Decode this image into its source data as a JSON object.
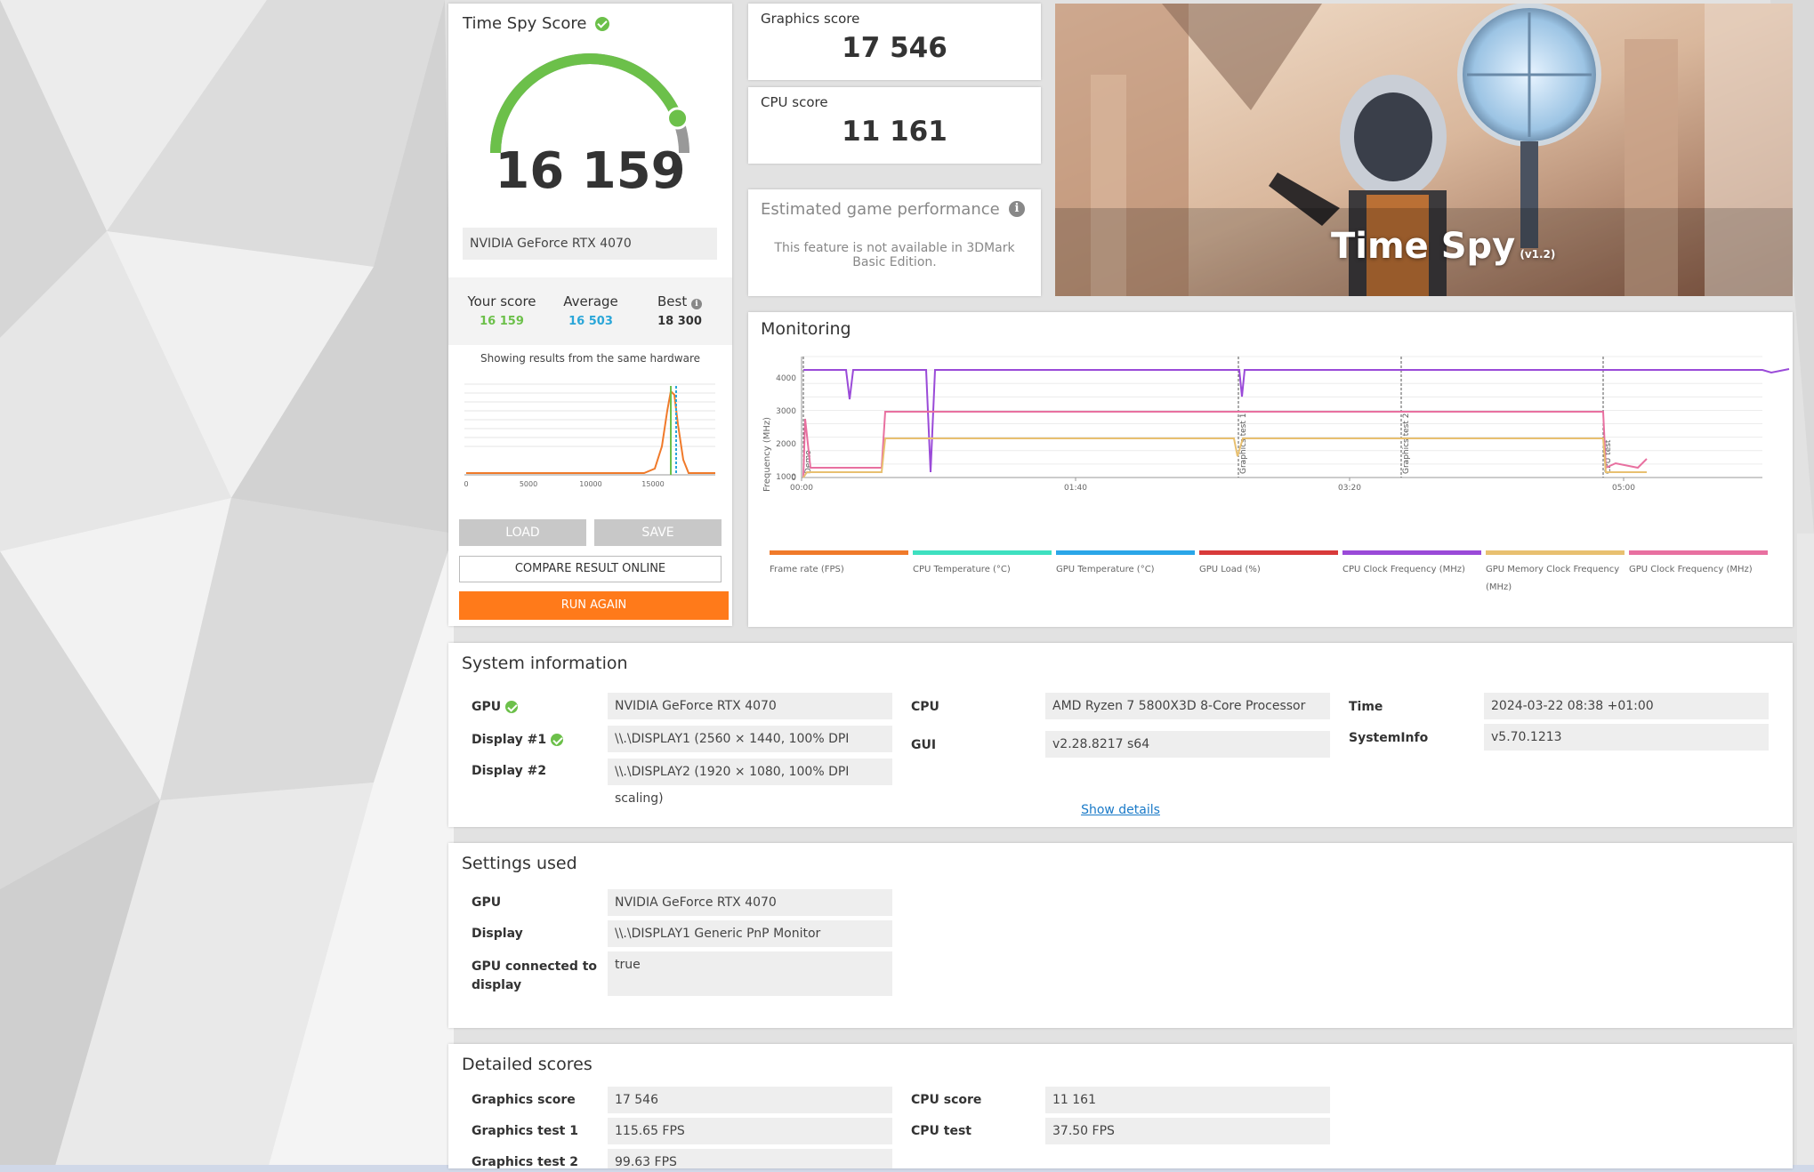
{
  "score_panel": {
    "title": "Time Spy Score",
    "score": "16 159",
    "gpu_name": "NVIDIA GeForce RTX 4070",
    "your_score_label": "Your score",
    "your_score_value": "16 159",
    "average_label": "Average",
    "average_value": "16 503",
    "best_label": "Best",
    "best_value": "18 300",
    "showing_results": "Showing results from the same hardware",
    "histogram_ticks": [
      "0",
      "5000",
      "10000",
      "15000"
    ],
    "load_label": "LOAD",
    "save_label": "SAVE",
    "compare_label": "COMPARE RESULT ONLINE",
    "run_again_label": "RUN AGAIN",
    "gauge_fraction": 0.88,
    "colors": {
      "accent_green": "#6cc04a",
      "average_blue": "#2aa6d8",
      "run_orange": "#ff7a1a"
    }
  },
  "graphics_score": {
    "label": "Graphics score",
    "value": "17 546"
  },
  "cpu_score": {
    "label": "CPU score",
    "value": "11 161"
  },
  "estimated": {
    "title": "Estimated game performance",
    "message": "This feature is not available in 3DMark Basic Edition."
  },
  "banner": {
    "title": "Time Spy",
    "version": "(v1.2)"
  },
  "monitoring": {
    "title": "Monitoring",
    "ylabel": "Frequency (MHz)",
    "y_ticks": [
      "4000",
      "3000",
      "2000",
      "1000",
      "0"
    ],
    "x_ticks": [
      "00:00",
      "01:40",
      "03:20",
      "05:00"
    ],
    "markers": [
      "Demo",
      "Graphics test 1",
      "Graphics test 2",
      "CPU test"
    ],
    "legend": [
      {
        "label": "Frame rate (FPS)",
        "color": "#f07a2a"
      },
      {
        "label": "CPU Temperature (°C)",
        "color": "#3ee0c0"
      },
      {
        "label": "GPU Temperature (°C)",
        "color": "#2aa6e8"
      },
      {
        "label": "GPU Load (%)",
        "color": "#d83a3a"
      },
      {
        "label": "CPU Clock Frequency (MHz)",
        "color": "#9a4ad8"
      },
      {
        "label": "GPU Memory Clock Frequency (MHz)",
        "color": "#e8c070"
      },
      {
        "label": "GPU Clock Frequency (MHz)",
        "color": "#e870a0"
      }
    ]
  },
  "system_info": {
    "title": "System information",
    "gpu_label": "GPU",
    "gpu_value": "NVIDIA GeForce RTX 4070",
    "display1_label": "Display #1",
    "display1_value": "\\\\.\\DISPLAY1 (2560 × 1440, 100% DPI scaling)",
    "display2_label": "Display #2",
    "display2_value": "\\\\.\\DISPLAY2 (1920 × 1080, 100% DPI scaling)",
    "cpu_label": "CPU",
    "cpu_value": "AMD Ryzen 7 5800X3D 8-Core Processor",
    "gui_label": "GUI",
    "gui_value": "v2.28.8217 s64",
    "time_label": "Time",
    "time_value": "2024-03-22 08:38 +01:00",
    "sysinfo_label": "SystemInfo",
    "sysinfo_value": "v5.70.1213",
    "show_details": "Show details"
  },
  "settings": {
    "title": "Settings used",
    "gpu_label": "GPU",
    "gpu_value": "NVIDIA GeForce RTX 4070",
    "display_label": "Display",
    "display_value": "\\\\.\\DISPLAY1 Generic PnP Monitor",
    "connected_label_1": "GPU connected to",
    "connected_label_2": "display",
    "connected_value": "true"
  },
  "detailed": {
    "title": "Detailed scores",
    "graphics_score_label": "Graphics score",
    "graphics_score_value": "17 546",
    "gt1_label": "Graphics test 1",
    "gt1_value": "115.65 FPS",
    "gt2_label": "Graphics test 2",
    "gt2_value": "99.63 FPS",
    "cpu_score_label": "CPU score",
    "cpu_score_value": "11 161",
    "cpu_test_label": "CPU test",
    "cpu_test_value": "37.50 FPS"
  }
}
